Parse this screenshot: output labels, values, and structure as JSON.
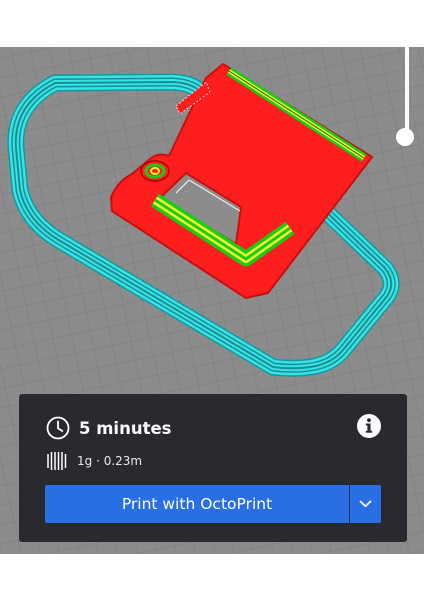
{
  "viewport": {
    "description_icons": [
      "build-plate-grid",
      "skirt-toolpath",
      "model-wall-toolpath",
      "infill-toolpath"
    ],
    "colors": {
      "plate": "#8c8c8c",
      "grid": "#7a7a7a",
      "skirt": "#36e3e6",
      "wall": "#ff1e1e",
      "infill_outer": "#19cc19",
      "infill_inner": "#f4f42a"
    }
  },
  "job_panel": {
    "print_time": "5 minutes",
    "material_usage": "1g · 0.23m",
    "icons": {
      "time": "clock-icon",
      "info": "info-icon",
      "material": "spool-icon",
      "menu": "chevron-down-icon"
    }
  },
  "actions": {
    "print_button_label": "Print with OctoPrint",
    "accent": "#2a6ee6"
  }
}
